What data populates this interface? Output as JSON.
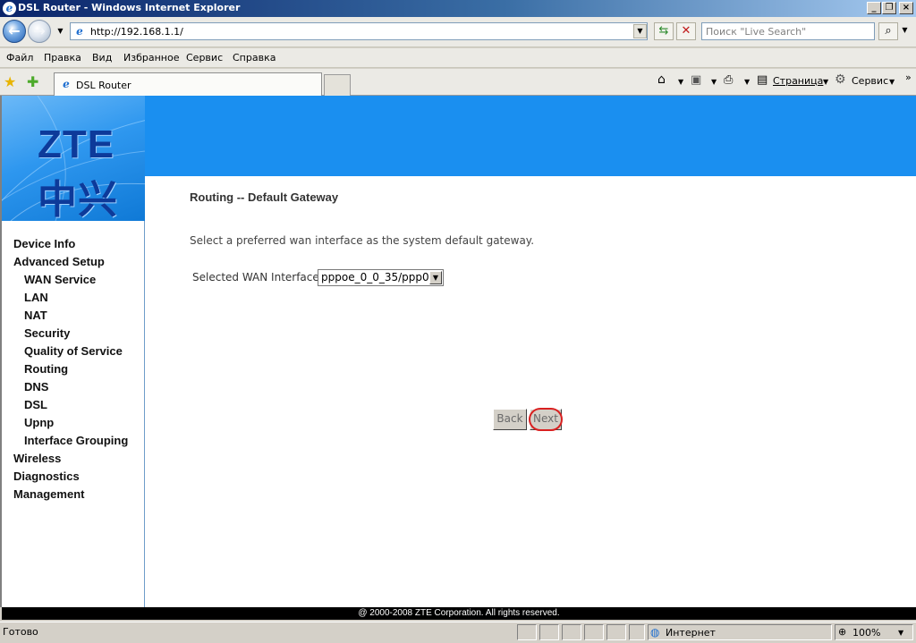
{
  "window": {
    "title": "DSL Router - Windows Internet Explorer"
  },
  "address_bar": {
    "url": "http://192.168.1.1/",
    "search_placeholder": "Поиск \"Live Search\""
  },
  "menu": [
    "Файл",
    "Правка",
    "Вид",
    "Избранное",
    "Сервис",
    "Справка"
  ],
  "tab": {
    "title": "DSL Router"
  },
  "toolbar": {
    "page_label": "Страница",
    "tools_label": "Сервис"
  },
  "brand": {
    "logo_text": "ZTE中兴"
  },
  "sidebar": {
    "items": [
      {
        "label": "Device Info",
        "level": 0
      },
      {
        "label": "Advanced Setup",
        "level": 0
      },
      {
        "label": "WAN Service",
        "level": 1
      },
      {
        "label": "LAN",
        "level": 1
      },
      {
        "label": "NAT",
        "level": 1
      },
      {
        "label": "Security",
        "level": 1
      },
      {
        "label": "Quality of Service",
        "level": 1
      },
      {
        "label": "Routing",
        "level": 1
      },
      {
        "label": "DNS",
        "level": 1
      },
      {
        "label": "DSL",
        "level": 1
      },
      {
        "label": "Upnp",
        "level": 1
      },
      {
        "label": "Interface Grouping",
        "level": 1
      },
      {
        "label": "Wireless",
        "level": 0
      },
      {
        "label": "Diagnostics",
        "level": 0
      },
      {
        "label": "Management",
        "level": 0
      }
    ]
  },
  "main": {
    "title": "Routing -- Default Gateway",
    "description": "Select a preferred wan interface as the system default gateway.",
    "wan_label": "Selected WAN Interface",
    "wan_selected": "pppoe_0_0_35/ppp0",
    "back_label": "Back",
    "next_label": "Next"
  },
  "footer": {
    "copyright": "@ 2000-2008 ZTE Corporation. All rights reserved."
  },
  "status": {
    "left_text": "Готово",
    "zone": "Интернет",
    "zoom": "100%"
  },
  "colors": {
    "banner": "#1a8ff0",
    "highlight_ring": "#d92020"
  }
}
